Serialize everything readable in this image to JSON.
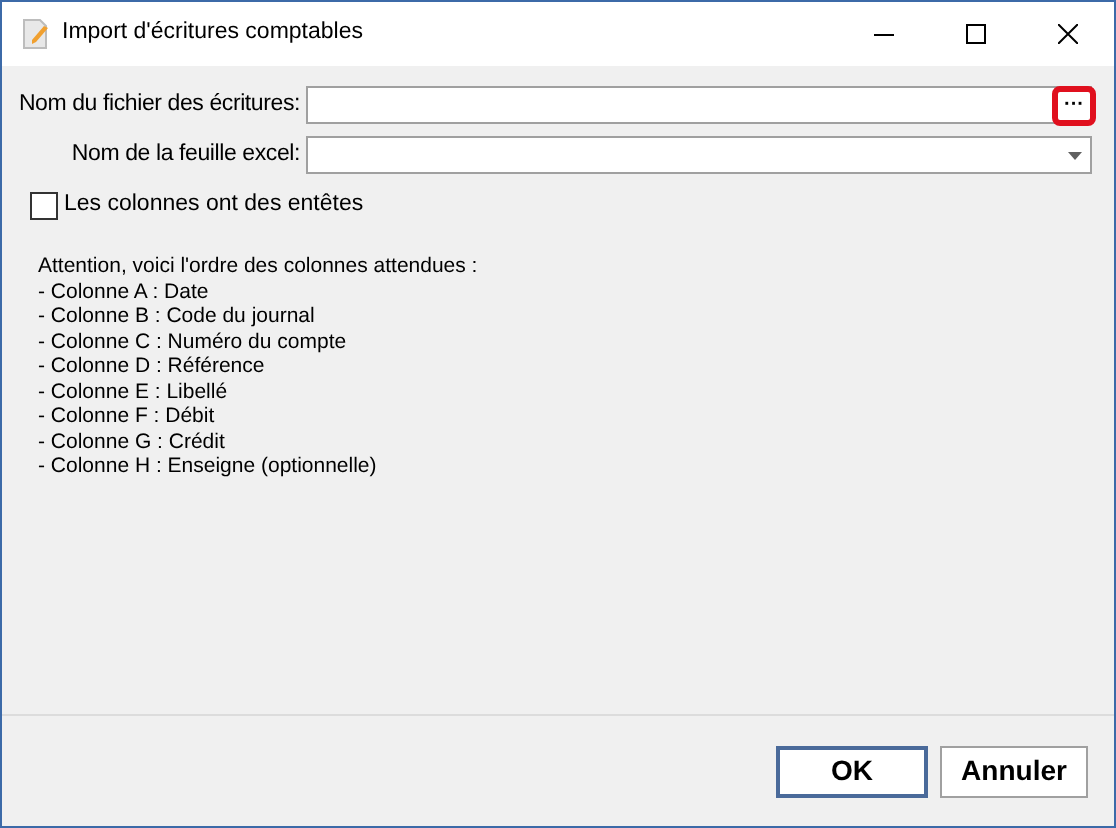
{
  "window": {
    "title": "Import d'écritures comptables"
  },
  "fields": [
    {
      "kind": "browse",
      "label": "Nom du fichier des écritures:",
      "button": "···",
      "highlighted": true
    },
    {
      "kind": "dropdown",
      "label": "Nom de la feuille excel:"
    }
  ],
  "header_checkbox": {
    "label": "Les colonnes ont des entêtes",
    "checked": false
  },
  "instructions": [
    "Attention, voici l'ordre des colonnes attendues :",
    "- Colonne A : Date",
    "- Colonne B : Code du journal",
    "- Colonne C : Numéro du compte",
    "- Colonne D : Référence",
    "- Colonne E : Libellé",
    "- Colonne F : Débit",
    "- Colonne G : Crédit",
    "- Colonne H : Enseigne (optionnelle)"
  ],
  "buttons": [
    {
      "label": "OK",
      "default": true
    },
    {
      "label": "Annuler",
      "default": false
    }
  ]
}
